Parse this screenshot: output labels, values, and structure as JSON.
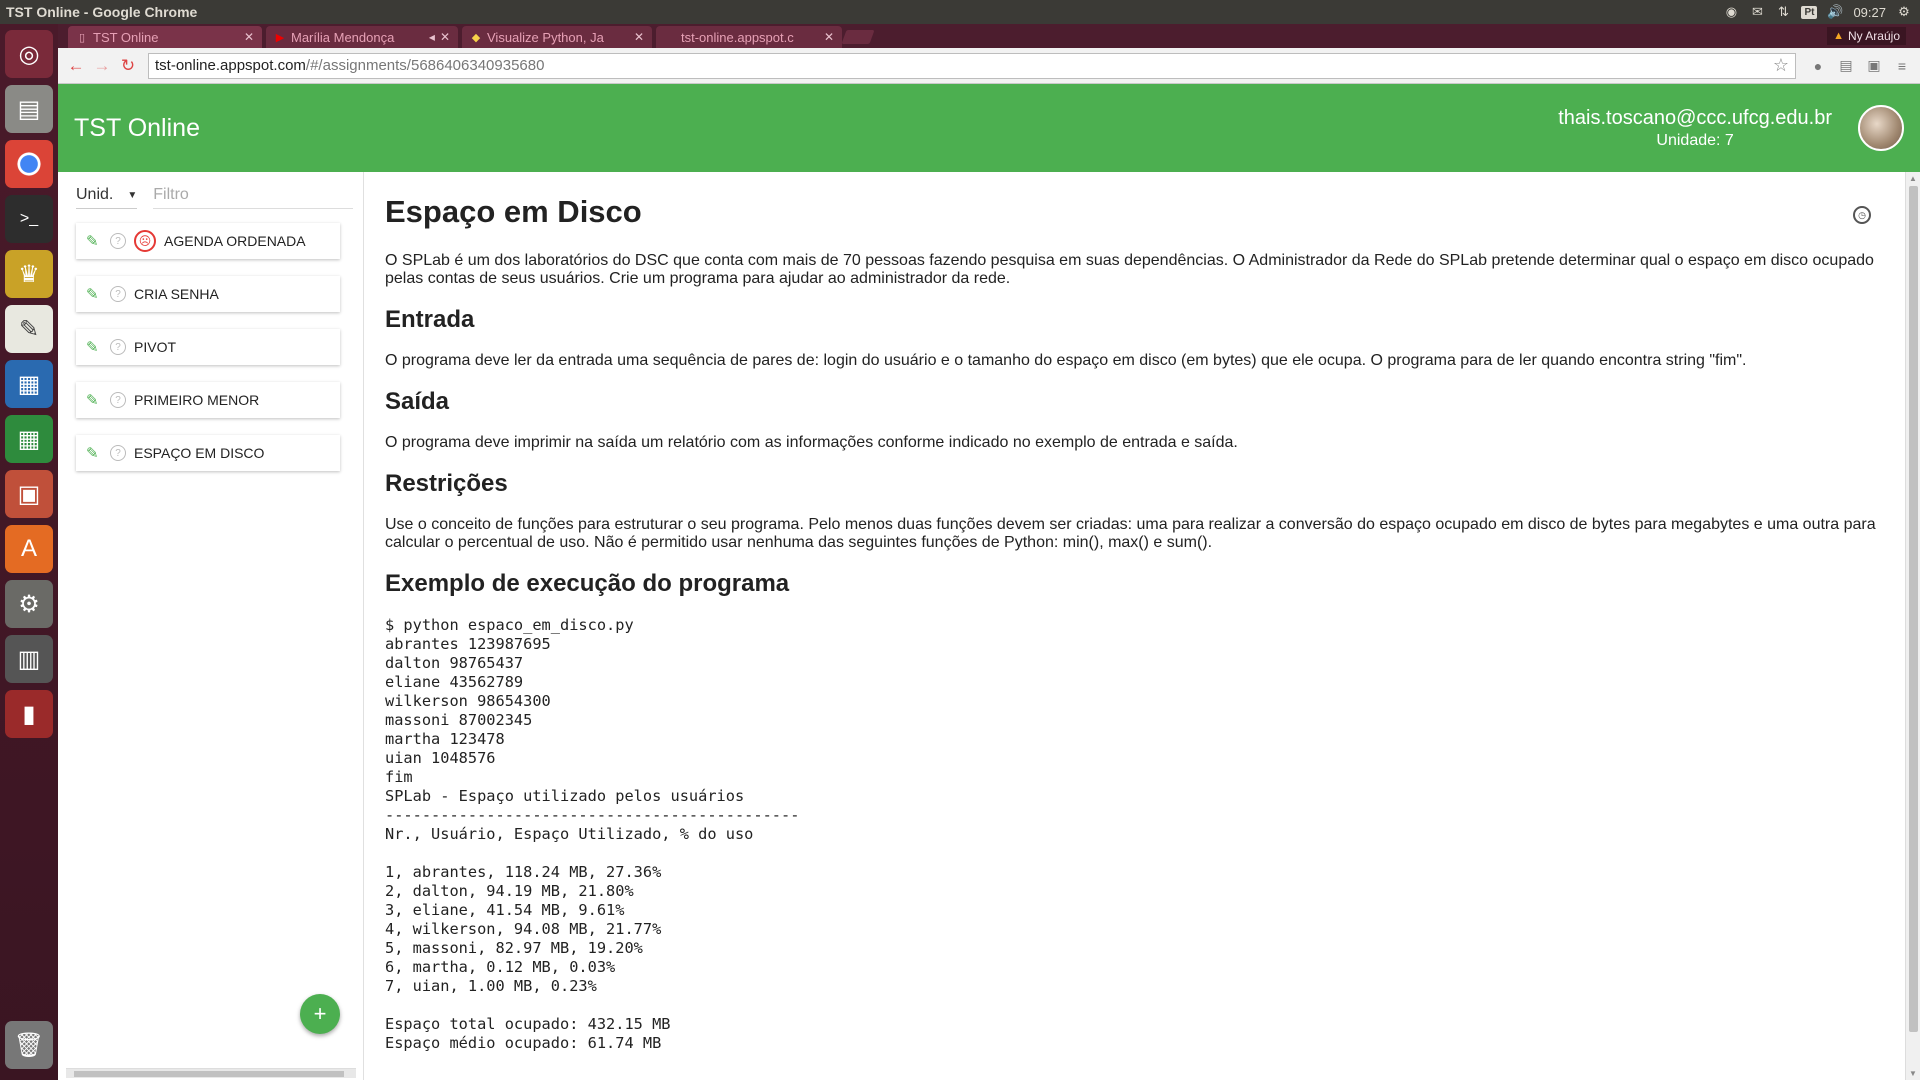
{
  "window": {
    "title": "TST Online - Google Chrome"
  },
  "tray": {
    "lang": "Pt",
    "time": "09:27"
  },
  "tabs": [
    {
      "label": "TST Online",
      "active": true
    },
    {
      "label": "Marília Mendonça",
      "active": false
    },
    {
      "label": "Visualize Python, Ja",
      "active": false
    },
    {
      "label": "tst-online.appspot.c",
      "active": false
    }
  ],
  "profile": {
    "name": "Ny Araújo"
  },
  "address": {
    "host": "tst-online.appspot.com",
    "path": "/#/assignments/5686406340935680"
  },
  "header": {
    "title": "TST Online",
    "email": "thais.toscano@ccc.ufcg.edu.br",
    "unit": "Unidade: 7"
  },
  "sidebar": {
    "unit_select": "Unid.",
    "filter_placeholder": "Filtro",
    "items": [
      {
        "label": "AGENDA ORDENADA",
        "failed": true
      },
      {
        "label": "CRIA SENHA",
        "failed": false
      },
      {
        "label": "PIVOT",
        "failed": false
      },
      {
        "label": "PRIMEIRO MENOR",
        "failed": false
      },
      {
        "label": "ESPAÇO EM DISCO",
        "failed": false
      }
    ]
  },
  "problem": {
    "title": "Espaço em Disco",
    "intro": "O SPLab é um dos laboratórios do DSC que conta com mais de 70 pessoas fazendo pesquisa em suas dependências. O Administrador da Rede do SPLab pretende determinar qual o espaço em disco ocupado pelas contas de seus usuários. Crie um programa para ajudar ao administrador da rede.",
    "entrada_title": "Entrada",
    "entrada_text": "O programa deve ler da entrada uma sequência de pares de: login do usuário e o tamanho do espaço em disco (em bytes) que ele ocupa. O programa para de ler quando encontra string \"fim\".",
    "saida_title": "Saída",
    "saida_text": "O programa deve imprimir na saída um relatório com as informações conforme indicado no exemplo de entrada e saída.",
    "restricoes_title": "Restrições",
    "restricoes_text": "Use o conceito de funções para estruturar o seu programa. Pelo menos duas funções devem ser criadas: uma para realizar a conversão do espaço ocupado em disco de bytes para megabytes e uma outra para calcular o percentual de uso. Não é permitido usar nenhuma das seguintes funções de Python: min(), max() e sum().",
    "exemplo_title": "Exemplo de execução do programa",
    "exemplo_code": "$ python espaco_em_disco.py\nabrantes 123987695\ndalton 98765437\neliane 43562789\nwilkerson 98654300\nmassoni 87002345\nmartha 123478\nuian 1048576\nfim\nSPLab - Espaço utilizado pelos usuários\n---------------------------------------------\nNr., Usuário, Espaço Utilizado, % do uso\n\n1, abrantes, 118.24 MB, 27.36%\n2, dalton, 94.19 MB, 21.80%\n3, eliane, 41.54 MB, 9.61%\n4, wilkerson, 94.08 MB, 21.77%\n5, massoni, 82.97 MB, 19.20%\n6, martha, 0.12 MB, 0.03%\n7, uian, 1.00 MB, 0.23%\n\nEspaço total ocupado: 432.15 MB\nEspaço médio ocupado: 61.74 MB"
  }
}
